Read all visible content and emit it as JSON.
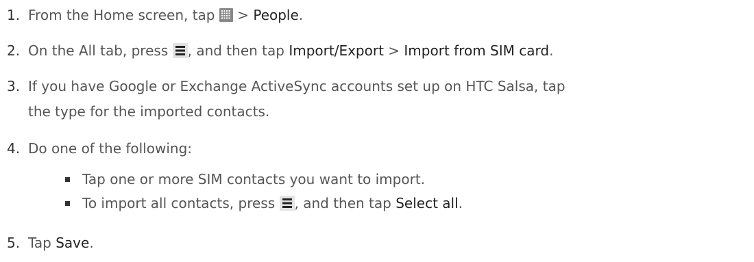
{
  "steps": [
    {
      "number": "1.",
      "t1": "From the Home screen, tap ",
      "t2": " > ",
      "b1": "People",
      "t3": "."
    },
    {
      "number": "2.",
      "t1": "On the All tab, press ",
      "t2": ", and then tap ",
      "b1": "Import/Export",
      "t3": " > ",
      "b2": "Import from SIM card",
      "t4": "."
    },
    {
      "number": "3.",
      "line1": "If you have Google or Exchange ActiveSync accounts set up on HTC Salsa, tap",
      "line2": "the type for the imported contacts."
    },
    {
      "number": "4.",
      "t1": "Do one of the following:",
      "bullets": [
        {
          "text": "Tap one or more SIM contacts you want to import."
        },
        {
          "t1": "To import all contacts, press ",
          "t2": ", and then tap ",
          "b1": "Select all",
          "t3": "."
        }
      ]
    },
    {
      "number": "5.",
      "t1": "Tap ",
      "b1": "Save",
      "t2": "."
    }
  ],
  "icons": {
    "all_apps": "all-apps-grid-icon",
    "menu": "menu-icon"
  }
}
